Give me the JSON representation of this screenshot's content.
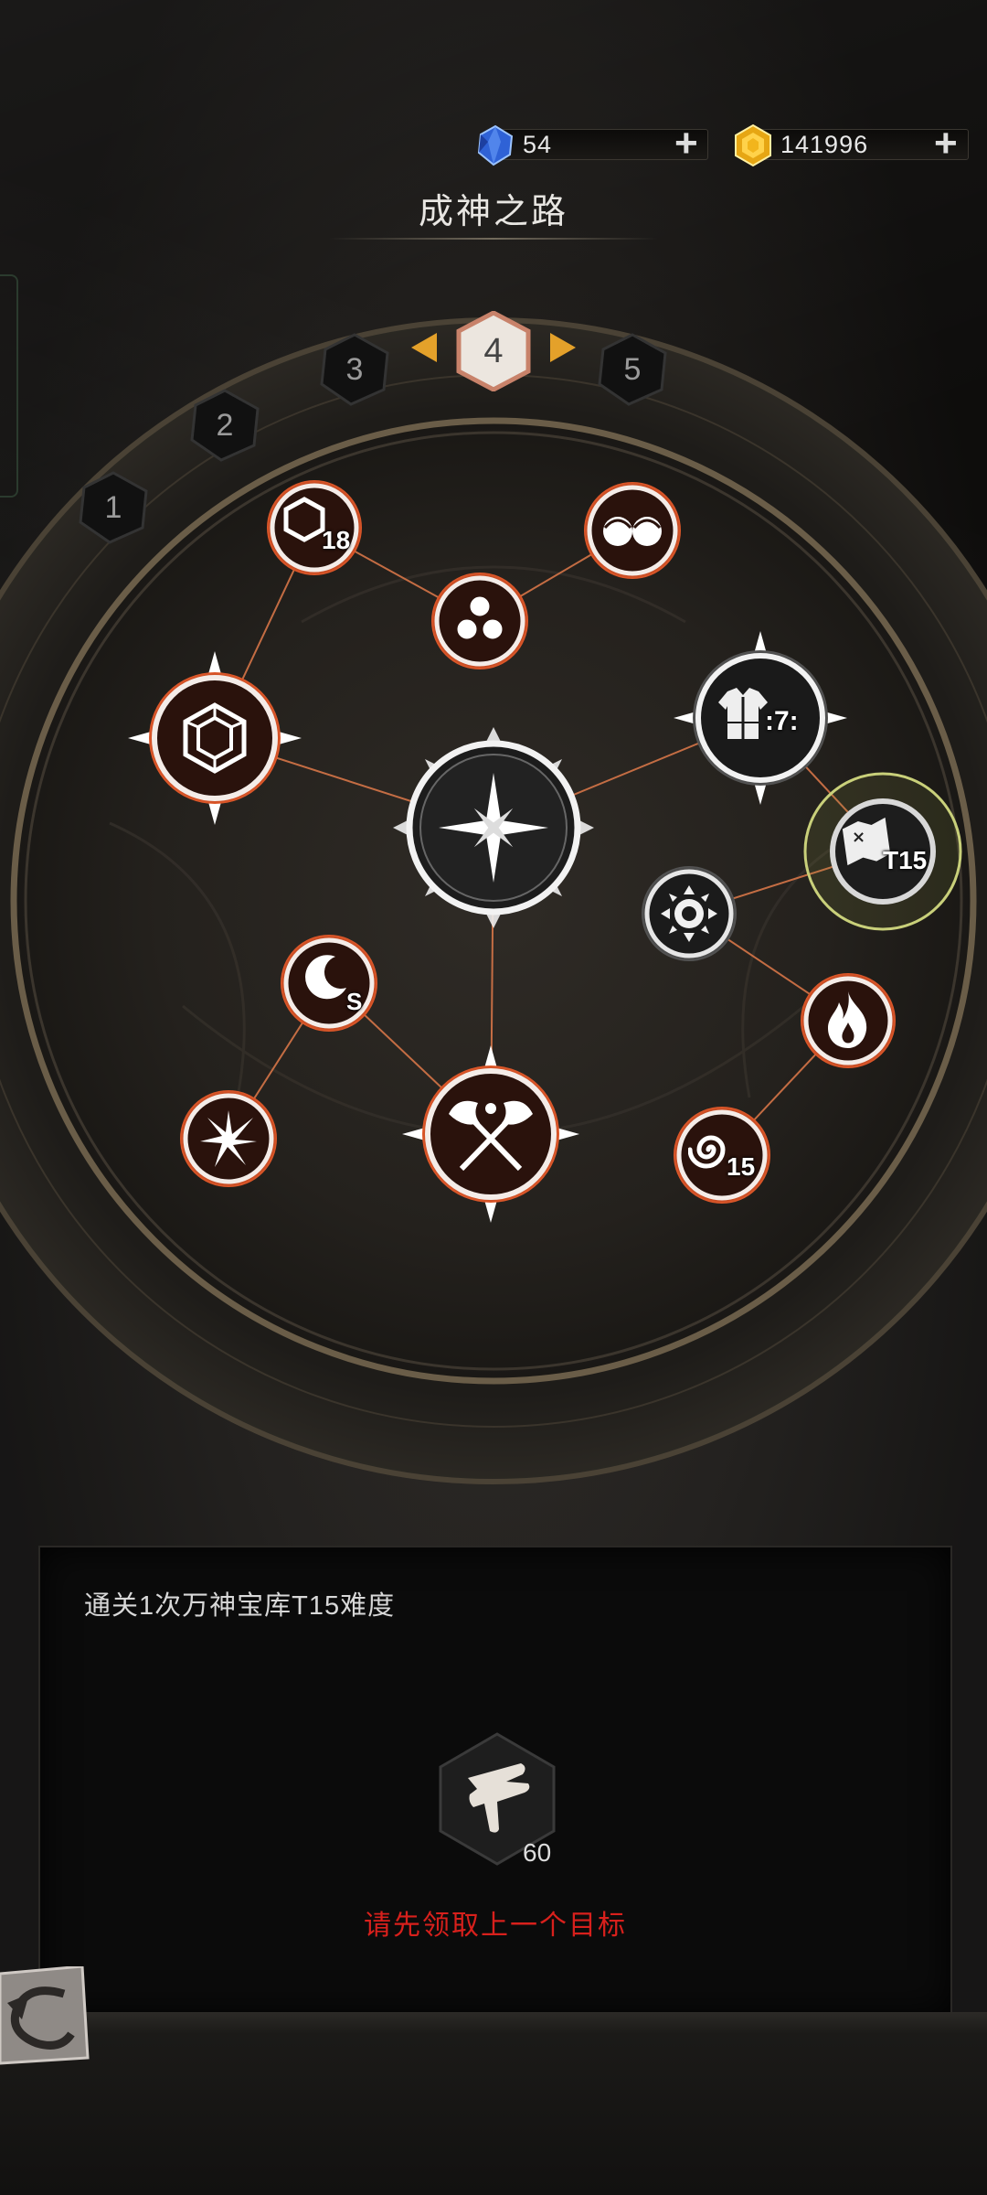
{
  "currency": {
    "diamond": {
      "icon": "blue-crystal-icon",
      "value": "54"
    },
    "gold": {
      "icon": "gold-coin-icon",
      "value": "141996"
    }
  },
  "title": "成神之路",
  "tiers": [
    {
      "label": "1",
      "state": "locked"
    },
    {
      "label": "2",
      "state": "locked"
    },
    {
      "label": "3",
      "state": "locked"
    },
    {
      "label": "4",
      "state": "current"
    },
    {
      "label": "5",
      "state": "locked"
    }
  ],
  "nodes": {
    "center": {
      "icon": "compass-star-icon"
    },
    "hexagon_gem": {
      "icon": "hexagon-gem-icon"
    },
    "hex_18": {
      "icon": "hexagon-outline-icon",
      "label": "18"
    },
    "triple_orbs": {
      "icon": "triple-orb-icon"
    },
    "double_orbs": {
      "icon": "double-orb-icon"
    },
    "armor_set": {
      "icon": "armor-icon",
      "label": ":7:"
    },
    "vault_t15": {
      "icon": "map-scroll-icon",
      "label": "T15",
      "selected": true
    },
    "gear": {
      "icon": "gear-icon"
    },
    "fire": {
      "icon": "flame-icon"
    },
    "spiral_15": {
      "icon": "spiral-icon",
      "label": "15"
    },
    "crescent_s": {
      "icon": "crescent-icon",
      "label": "S"
    },
    "crossed_axes": {
      "icon": "crossed-axes-icon"
    },
    "burst": {
      "icon": "burst-icon"
    }
  },
  "task": {
    "description": "通关1次万神宝库T15难度",
    "reward": {
      "icon": "feather-scroll-icon",
      "count": "60"
    },
    "warning": "请先领取上一个目标"
  },
  "colors": {
    "accent_orange": "#e4a12a",
    "node_glow": "#c9502a",
    "warning_red": "#d8201c",
    "selected_ring": "#c9d07a"
  }
}
